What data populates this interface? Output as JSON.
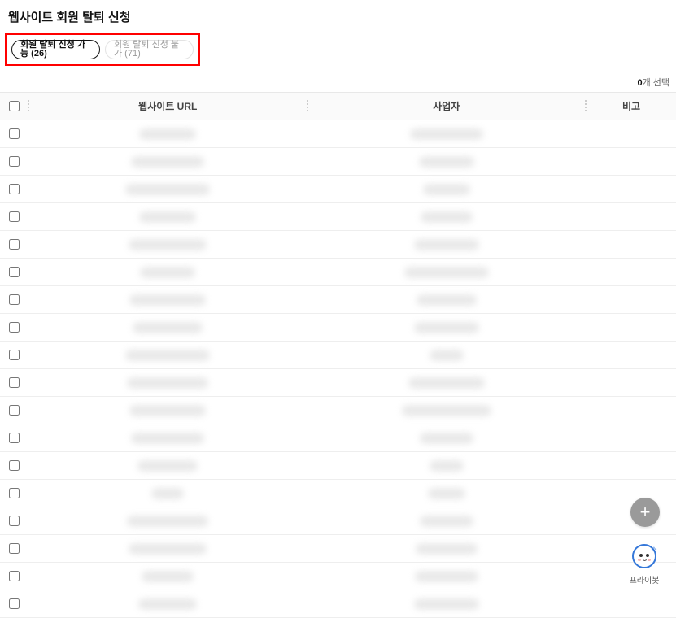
{
  "page": {
    "title": "웹사이트 회원 탈퇴 신청"
  },
  "tabs": {
    "active": {
      "label": "회원 탈퇴 신청 가능 (26)"
    },
    "inactive": {
      "label": "회원 탈퇴 신청 불가 (71)"
    }
  },
  "selection": {
    "count": "0",
    "suffix": "개 선택"
  },
  "table": {
    "headers": {
      "url": "웹사이트 URL",
      "biz": "사업자",
      "note": "비고"
    },
    "rows": [
      {
        "url_w": 70,
        "url_h": 14,
        "biz_w": 90,
        "biz_h": 14
      },
      {
        "url_w": 90,
        "url_h": 14,
        "biz_w": 68,
        "biz_h": 14
      },
      {
        "url_w": 104,
        "url_h": 14,
        "biz_w": 58,
        "biz_h": 14
      },
      {
        "url_w": 70,
        "url_h": 14,
        "biz_w": 64,
        "biz_h": 14
      },
      {
        "url_w": 96,
        "url_h": 14,
        "biz_w": 80,
        "biz_h": 14
      },
      {
        "url_w": 68,
        "url_h": 14,
        "biz_w": 104,
        "biz_h": 14
      },
      {
        "url_w": 94,
        "url_h": 14,
        "biz_w": 74,
        "biz_h": 14
      },
      {
        "url_w": 86,
        "url_h": 14,
        "biz_w": 80,
        "biz_h": 14
      },
      {
        "url_w": 104,
        "url_h": 14,
        "biz_w": 42,
        "biz_h": 14
      },
      {
        "url_w": 100,
        "url_h": 14,
        "biz_w": 94,
        "biz_h": 14
      },
      {
        "url_w": 94,
        "url_h": 14,
        "biz_w": 110,
        "biz_h": 14
      },
      {
        "url_w": 90,
        "url_h": 14,
        "biz_w": 66,
        "biz_h": 14
      },
      {
        "url_w": 74,
        "url_h": 14,
        "biz_w": 42,
        "biz_h": 14
      },
      {
        "url_w": 40,
        "url_h": 14,
        "biz_w": 46,
        "biz_h": 14
      },
      {
        "url_w": 100,
        "url_h": 14,
        "biz_w": 66,
        "biz_h": 14
      },
      {
        "url_w": 96,
        "url_h": 14,
        "biz_w": 76,
        "biz_h": 14
      },
      {
        "url_w": 64,
        "url_h": 14,
        "biz_w": 78,
        "biz_h": 14
      },
      {
        "url_w": 72,
        "url_h": 14,
        "biz_w": 80,
        "biz_h": 14
      }
    ]
  },
  "mascot": {
    "label": "프라이봇"
  }
}
